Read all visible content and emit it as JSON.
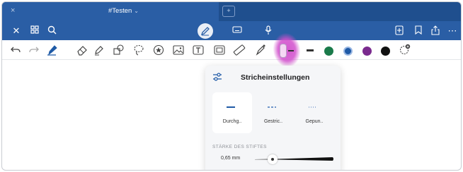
{
  "window": {
    "tab_close": "×",
    "tab_title": "#Testen",
    "tab_chevron": "⌄",
    "new_tab_label": "+"
  },
  "appbar": {
    "close": "✕",
    "grid": "⊞",
    "search": "⌕",
    "keyboard": "⌨",
    "mic": "🎙",
    "add": "⊞",
    "bookmark": "⊏",
    "share": "⇧",
    "more": "⋯"
  },
  "toolbar": {
    "colors": [
      "#1a7a4a",
      "#1f5aa6",
      "#7a2a8e",
      "#111111"
    ],
    "selected_color": "#1f5aa6"
  },
  "stroke_settings": {
    "title": "Stricheinstellungen",
    "styles": [
      {
        "label": "Durchg..",
        "selected": true
      },
      {
        "label": "Gestric..",
        "selected": false
      },
      {
        "label": "Gepun..",
        "selected": false
      }
    ],
    "thickness_label": "STÄRKE DES STIFTES",
    "thickness_value": "0,65 mm",
    "thickness_level": 0.2
  }
}
